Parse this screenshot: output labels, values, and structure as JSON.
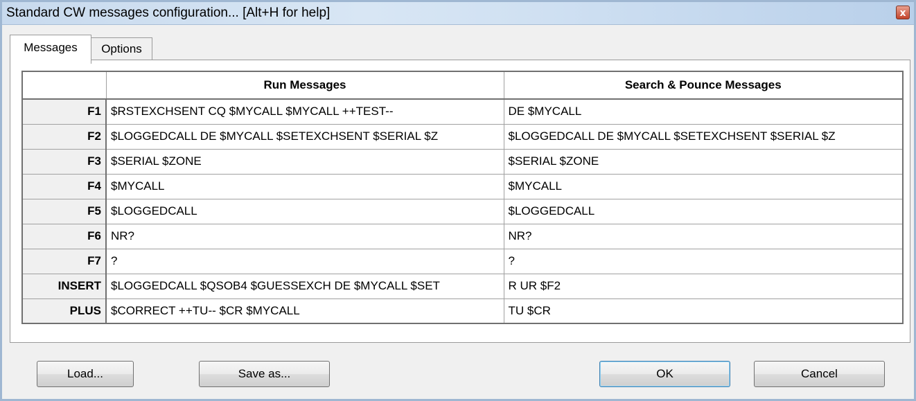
{
  "window": {
    "title": "Standard CW messages configuration... [Alt+H for help]",
    "close_glyph": "x"
  },
  "tabs": [
    {
      "label": "Messages",
      "active": true
    },
    {
      "label": "Options",
      "active": false
    }
  ],
  "grid": {
    "columns": [
      "",
      "Run Messages",
      "Search & Pounce Messages"
    ],
    "rows": [
      {
        "key": "F1",
        "run": "$RSTEXCHSENT CQ $MYCALL $MYCALL ++TEST--",
        "snp": "DE $MYCALL"
      },
      {
        "key": "F2",
        "run": "$LOGGEDCALL DE $MYCALL $SETEXCHSENT $SERIAL $Z",
        "snp": "$LOGGEDCALL DE $MYCALL $SETEXCHSENT $SERIAL $Z"
      },
      {
        "key": "F3",
        "run": "$SERIAL $ZONE",
        "snp": "$SERIAL $ZONE"
      },
      {
        "key": "F4",
        "run": "$MYCALL",
        "snp": "$MYCALL"
      },
      {
        "key": "F5",
        "run": "$LOGGEDCALL",
        "snp": "$LOGGEDCALL"
      },
      {
        "key": "F6",
        "run": "NR?",
        "snp": "NR?"
      },
      {
        "key": "F7",
        "run": "?",
        "snp": "?"
      },
      {
        "key": "INSERT",
        "run": "$LOGGEDCALL $QSOB4 $GUESSEXCH DE $MYCALL $SET",
        "snp": "R UR $F2"
      },
      {
        "key": "PLUS",
        "run": "$CORRECT ++TU-- $CR $MYCALL",
        "snp": "TU $CR"
      }
    ]
  },
  "buttons": {
    "load": "Load...",
    "save_as": "Save as...",
    "ok": "OK",
    "cancel": "Cancel"
  }
}
